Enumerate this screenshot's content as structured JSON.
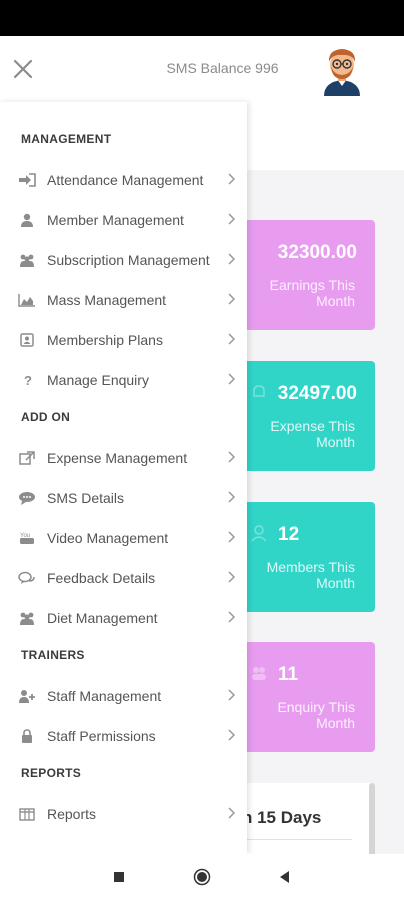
{
  "header": {
    "sms_balance": "SMS Balance 996"
  },
  "drawer": {
    "sections": [
      {
        "title": "MANAGEMENT",
        "items": [
          {
            "label": "Attendance Management",
            "icon": "sign-in-icon"
          },
          {
            "label": "Member Management",
            "icon": "user-icon"
          },
          {
            "label": "Subscription Management",
            "icon": "users-icon"
          },
          {
            "label": "Mass Management",
            "icon": "bar-chart-icon"
          },
          {
            "label": "Membership Plans",
            "icon": "contact-card-icon"
          },
          {
            "label": "Manage Enquiry",
            "icon": "question-icon"
          }
        ]
      },
      {
        "title": "ADD ON",
        "items": [
          {
            "label": "Expense Management",
            "icon": "external-link-icon"
          },
          {
            "label": "SMS Details",
            "icon": "chat-bubble-icon"
          },
          {
            "label": "Video Management",
            "icon": "youtube-icon"
          },
          {
            "label": "Feedback Details",
            "icon": "comments-icon"
          },
          {
            "label": "Diet Management",
            "icon": "users-icon"
          }
        ]
      },
      {
        "title": "TRAINERS",
        "items": [
          {
            "label": "Staff Management",
            "icon": "user-plus-icon"
          },
          {
            "label": "Staff Permissions",
            "icon": "lock-icon"
          }
        ]
      },
      {
        "title": "REPORTS",
        "items": [
          {
            "label": "Reports",
            "icon": "table-icon"
          }
        ]
      }
    ]
  },
  "cards": [
    {
      "value": "32300.00",
      "label": "Earnings This Month",
      "color": "#e89cf0"
    },
    {
      "value": "32497.00",
      "label": "Expense This Month",
      "color": "#30d5c8"
    },
    {
      "value": "12",
      "label": "Members This Month",
      "color": "#30d5c8"
    },
    {
      "value": "11",
      "label": "Enquiry This Month",
      "color": "#e89cf0"
    }
  ],
  "bottom_card": {
    "title": "n 15 Days"
  },
  "navbar": {
    "icons": [
      "recents-square-icon",
      "home-circle-icon",
      "back-triangle-icon"
    ]
  }
}
